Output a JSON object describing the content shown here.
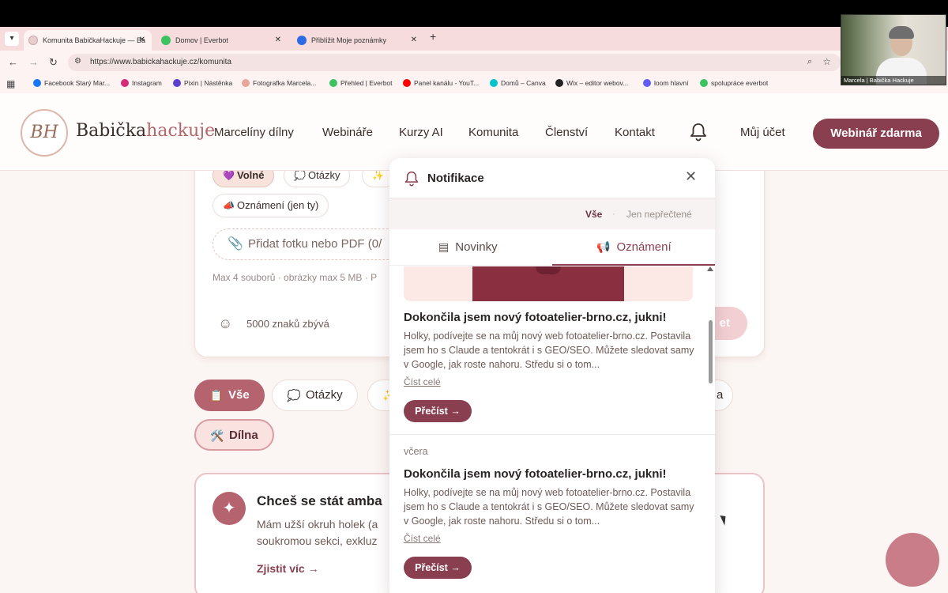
{
  "browser": {
    "tabs": [
      {
        "title": "Komunita BabičkaHackuje — Ba",
        "active": true,
        "icon": "site-favicon"
      },
      {
        "title": "Domov | Everbot",
        "active": false,
        "icon": "everbot-favicon"
      },
      {
        "title": "Přiblížit Moje poznámky",
        "active": false,
        "icon": "zoom-favicon"
      }
    ],
    "url": "https://www.babickahackuje.cz/komunita",
    "bookmarks": [
      {
        "label": "Facebook Starý Mar...",
        "color": "#1877f2"
      },
      {
        "label": "Instagram",
        "color": "#d62976"
      },
      {
        "label": "Pixin | Nástěnka",
        "color": "#5b3fd1"
      },
      {
        "label": "Fotografka Marcela...",
        "color": "#e8a598"
      },
      {
        "label": "Přehled | Everbot",
        "color": "#3ac35e"
      },
      {
        "label": "Panel kanálu - YouT...",
        "color": "#ff0000"
      },
      {
        "label": "Domů – Canva",
        "color": "#00c4cc"
      },
      {
        "label": "Wix – editor webov...",
        "color": "#222222"
      },
      {
        "label": "loom hlavní",
        "color": "#625df5"
      },
      {
        "label": "spolupráce everbot",
        "color": "#3ac35e"
      }
    ]
  },
  "webcam": {
    "label": "Marcela | Babička Hackuje"
  },
  "site": {
    "logo": {
      "monogram": "BH",
      "name_start": "Babička",
      "name_end": "hackuje"
    },
    "nav": [
      "Marcelíny dílny",
      "Webináře",
      "Kurzy AI",
      "Komunita",
      "Členství",
      "Kontakt"
    ],
    "account": "Můj účet",
    "cta": "Webinář zdarma",
    "composer": {
      "chips": [
        {
          "label": "Volné",
          "selected": true,
          "icon": "💜"
        },
        {
          "label": "Otázky",
          "selected": false,
          "icon": "💭"
        },
        {
          "label": "",
          "selected": false,
          "icon": "✨"
        },
        {
          "label": "Oznámení (jen ty)",
          "selected": false,
          "icon": "📣"
        }
      ],
      "attach": "Přidat fotku nebo PDF",
      "attach_count": "(0/",
      "limits": "Max 4 souborů · obrázky max 5 MB · P",
      "chars_left": "5000 znaků zbývá",
      "send_fragment": "et"
    },
    "filters": [
      {
        "label": "Vše",
        "state": "selected",
        "icon": "📋"
      },
      {
        "label": "Otázky",
        "state": "normal",
        "icon": "💭"
      },
      {
        "label": "",
        "state": "normal",
        "icon": "✨"
      },
      {
        "label": "a",
        "state": "normal",
        "icon": ""
      },
      {
        "label": "Dílna",
        "state": "outline",
        "icon": "🛠️"
      }
    ],
    "ambassador": {
      "title": "Chceš se stát amba",
      "line1": "Mám užší okruh holek (a",
      "line2": "soukromou sekci, exkluz",
      "link": "Zjistit víc →"
    }
  },
  "notifications": {
    "title": "Notifikace",
    "filter_all": "Vše",
    "filter_unread": "Jen nepřečtené",
    "tabs": [
      {
        "label": "Novinky",
        "active": false
      },
      {
        "label": "Oznámení",
        "active": true
      }
    ],
    "items": [
      {
        "date": "",
        "title": "Dokončila jsem nový fotoatelier-brno.cz, jukni!",
        "body": "Holky, podívejte se na můj nový web fotoatelier-brno.cz. Postavila jsem ho s Claude a tentokrát i s GEO/SEO. Můžete sledovat samy v Google, jak roste nahoru. Středu si o tom...",
        "more": "Číst celé",
        "button": "Přečíst →"
      },
      {
        "date": "včera",
        "title": "Dokončila jsem nový fotoatelier-brno.cz, jukni!",
        "body": "Holky, podívejte se na můj nový web fotoatelier-brno.cz. Postavila jsem ho s Claude a tentokrát i s GEO/SEO. Můžete sledovat samy v Google, jak roste nahoru. Středu si o tom...",
        "more": "Číst celé",
        "button": "Přečíst →"
      }
    ]
  },
  "colors": {
    "brand": "#8a3f50",
    "accent": "#b5636f",
    "background": "#fbf6f3"
  }
}
